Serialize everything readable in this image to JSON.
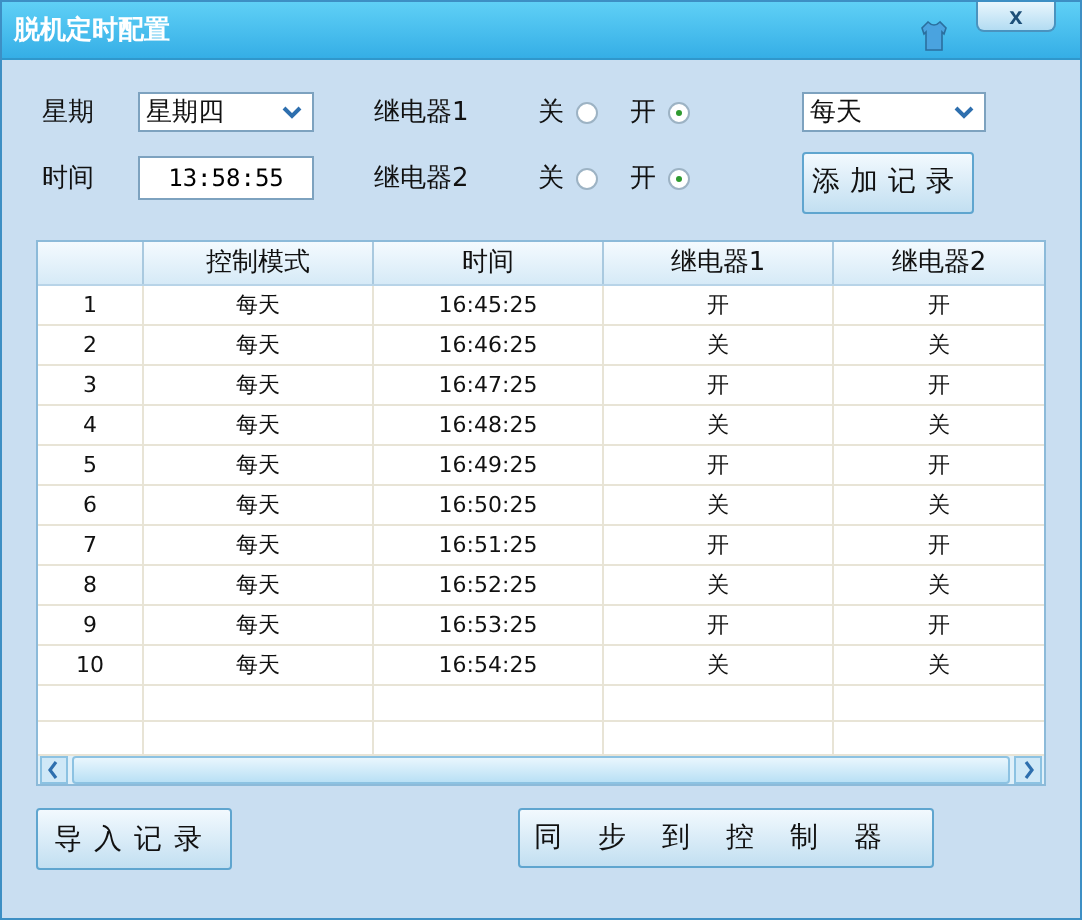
{
  "window": {
    "title": "脱机定时配置",
    "close": "x"
  },
  "form": {
    "weekday_label": "星期",
    "weekday": "星期四",
    "time_label": "时间",
    "time": "13:58:55",
    "mode": "每天",
    "add_button": "添加记录",
    "relays": [
      {
        "label": "继电器1",
        "options": [
          {
            "label": "关",
            "selected": false
          },
          {
            "label": "开",
            "selected": true
          }
        ]
      },
      {
        "label": "继电器2",
        "options": [
          {
            "label": "关",
            "selected": false
          },
          {
            "label": "开",
            "selected": true
          }
        ]
      }
    ]
  },
  "table": {
    "columns": [
      "",
      "控制模式",
      "时间",
      "继电器1",
      "继电器2"
    ],
    "rows": [
      [
        "1",
        "每天",
        "16:45:25",
        "开",
        "开"
      ],
      [
        "2",
        "每天",
        "16:46:25",
        "关",
        "关"
      ],
      [
        "3",
        "每天",
        "16:47:25",
        "开",
        "开"
      ],
      [
        "4",
        "每天",
        "16:48:25",
        "关",
        "关"
      ],
      [
        "5",
        "每天",
        "16:49:25",
        "开",
        "开"
      ],
      [
        "6",
        "每天",
        "16:50:25",
        "关",
        "关"
      ],
      [
        "7",
        "每天",
        "16:51:25",
        "开",
        "开"
      ],
      [
        "8",
        "每天",
        "16:52:25",
        "关",
        "关"
      ],
      [
        "9",
        "每天",
        "16:53:25",
        "开",
        "开"
      ],
      [
        "10",
        "每天",
        "16:54:25",
        "关",
        "关"
      ]
    ]
  },
  "buttons": {
    "import": "导入记录",
    "sync": "同步到控制器"
  }
}
